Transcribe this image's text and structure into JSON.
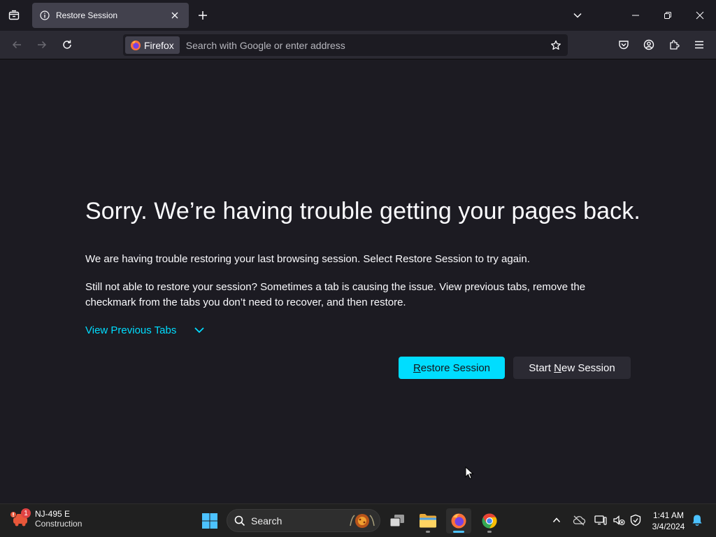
{
  "browser": {
    "tab": {
      "title": "Restore Session"
    },
    "identity_label": "Firefox",
    "url_placeholder": "Search with Google or enter address"
  },
  "page": {
    "title": "Sorry. We’re having trouble getting your pages back.",
    "paragraph1": "We are having trouble restoring your last browsing session. Select Restore Session to try again.",
    "paragraph2": "Still not able to restore your session? Sometimes a tab is causing the issue. View previous tabs, remove the checkmark from the tabs you don’t need to recover, and then restore.",
    "view_previous_tabs": "View Previous Tabs",
    "restore_button": {
      "access_key": "R",
      "rest": "estore Session"
    },
    "new_session_button": {
      "before": "Start ",
      "access_key": "N",
      "after": "ew Session"
    }
  },
  "taskbar": {
    "weather": {
      "title": "NJ-495 E",
      "subtitle": "Construction",
      "badge": "1"
    },
    "search_label": "Search",
    "clock": {
      "time": "1:41 AM",
      "date": "3/4/2024"
    }
  },
  "icons": {
    "tab_list": "tab-list-icon",
    "info": "info-icon",
    "close": "close-icon",
    "new_tab": "plus-icon",
    "overflow": "chevron-down-icon",
    "minimize": "minimize-icon",
    "restore": "restore-window-icon",
    "window_close": "close-window-icon",
    "back": "back-arrow-icon",
    "forward": "forward-arrow-icon",
    "reload": "reload-icon",
    "bookmark": "star-icon",
    "pocket": "pocket-icon",
    "account": "account-icon",
    "extensions": "extensions-icon",
    "menu": "hamburger-menu-icon"
  },
  "colors": {
    "accent": "#00ddff",
    "background": "#1c1b22",
    "toolbar": "#2b2a33"
  }
}
